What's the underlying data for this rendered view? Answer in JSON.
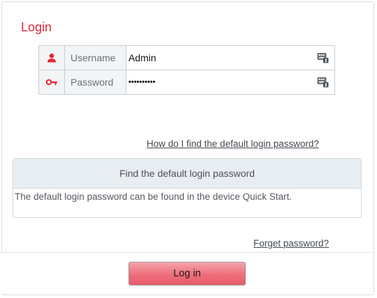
{
  "dialog": {
    "title": "Login"
  },
  "fields": {
    "username": {
      "label": "Username",
      "value": "Admin",
      "icon": "user-icon"
    },
    "password": {
      "label": "Password",
      "value": "••••••••••",
      "icon": "key-icon"
    },
    "keyboard_icon": "keyboard-icon"
  },
  "links": {
    "find_default_password": "How do I find the default login password?",
    "forget_password": "Forget password?"
  },
  "default_password_panel": {
    "header": "Find the default login password",
    "body": "The default login password can be found in the device Quick Start."
  },
  "footer": {
    "login_label": "Log in"
  },
  "colors": {
    "accent": "#e32636",
    "button_top": "#f5a3ab",
    "button_bottom": "#e85a69"
  }
}
